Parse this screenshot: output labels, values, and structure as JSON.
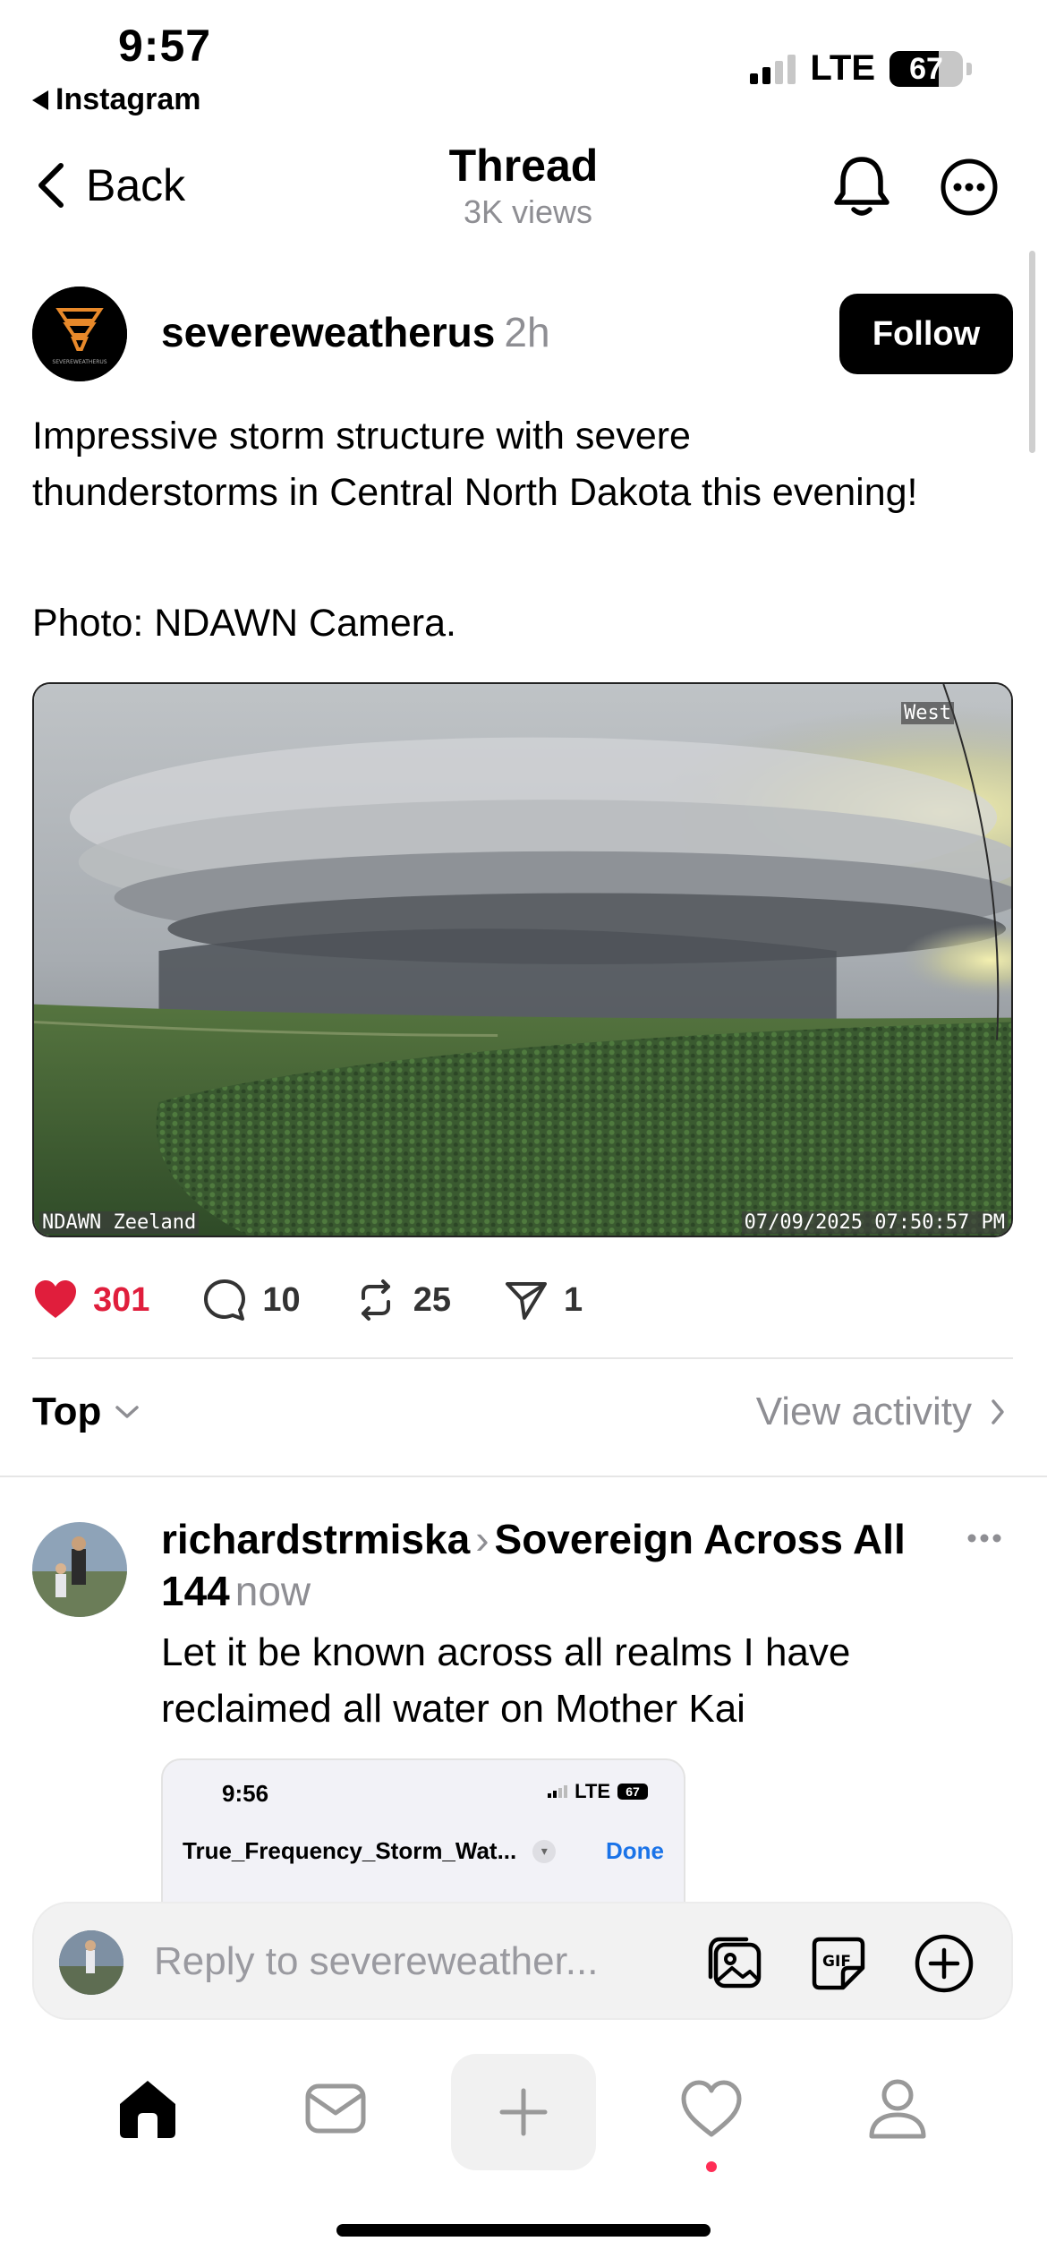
{
  "status_bar": {
    "time": "9:57",
    "back_app": "Instagram",
    "network": "LTE",
    "battery": "67",
    "battery_level": 0.67
  },
  "header": {
    "back_label": "Back",
    "title": "Thread",
    "views": "3K views"
  },
  "post": {
    "username": "severeweatherus",
    "time": "2h",
    "follow_label": "Follow",
    "text": "Impressive storm structure with severe thunderstorms in Central North Dakota this evening!",
    "credit": "Photo: NDAWN Camera.",
    "photo": {
      "direction_label": "West",
      "station_label": "NDAWN Zeeland",
      "timestamp": "07/09/2025 07:50:57 PM"
    },
    "avatar_text": "SEVEREWEATHERUS",
    "actions": {
      "likes": "301",
      "comments": "10",
      "reposts": "25",
      "shares": "1"
    }
  },
  "sort": {
    "label": "Top",
    "view_activity": "View activity"
  },
  "reply": {
    "username": "richardstrmiska",
    "target": "Sovereign Across All 144",
    "time": "now",
    "text": "Let it be known across all realms I have reclaimed all water on Mother Kai",
    "embed": {
      "time": "9:56",
      "network": "LTE",
      "battery": "67",
      "filename": "True_Frequency_Storm_Wat...",
      "done_label": "Done"
    }
  },
  "reply_bar": {
    "placeholder": "Reply to severeweather..."
  },
  "colors": {
    "like": "#e01e3c",
    "secondary_text": "#8e8e93",
    "link_blue": "#1a73e8",
    "notification_dot": "#ff2d55"
  }
}
